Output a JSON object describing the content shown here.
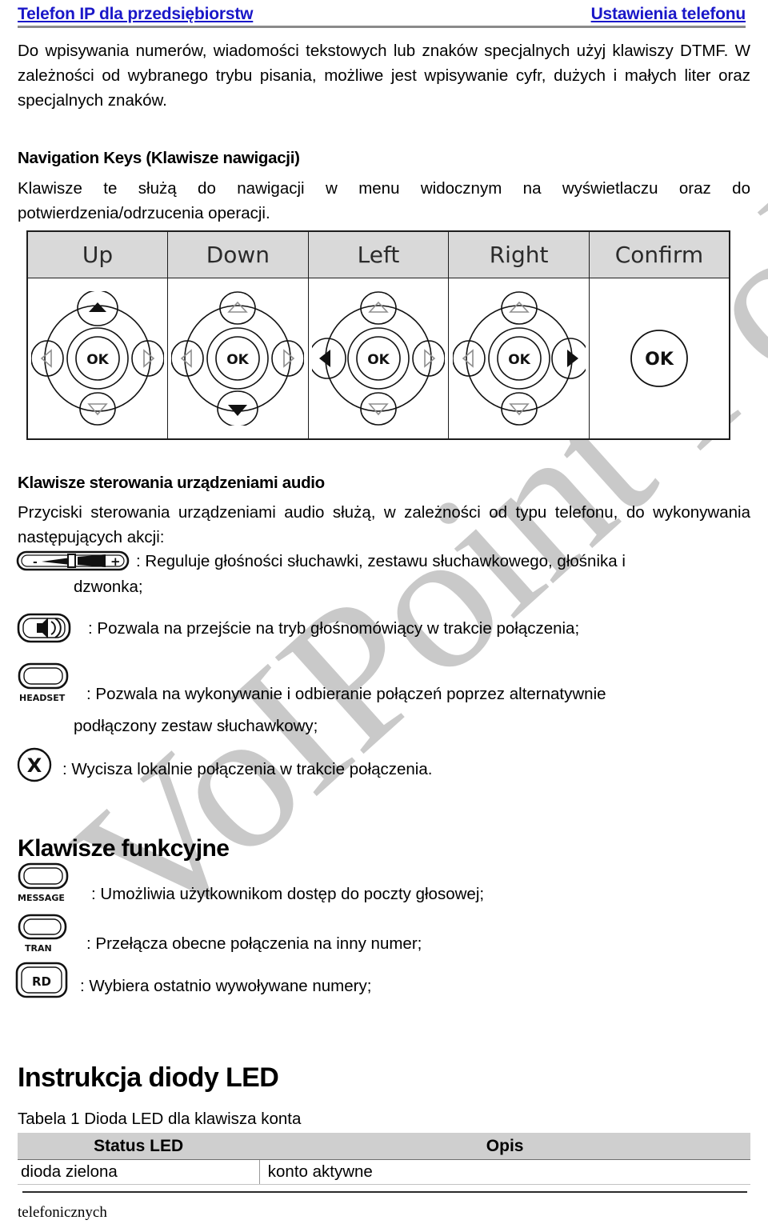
{
  "header": {
    "left": "Telefon IP dla przedsiębiorstw",
    "right": "Ustawienia telefonu",
    "color": "#1a17c8"
  },
  "intro_paragraph": "Do wpisywania numerów, wiadomości tekstowych lub znaków specjalnych użyj klawiszy DTMF. W zależności od wybranego trybu pisania, możliwe jest wpisywanie cyfr, dużych i małych liter oraz specjalnych znaków.",
  "navigation": {
    "heading": "Navigation Keys (Klawisze nawigacji)",
    "paragraph": "Klawisze te służą do nawigacji w menu widocznym na wyświetlaczu oraz do potwierdzenia/odrzucenia operacji.",
    "columns": [
      "Up",
      "Down",
      "Left",
      "Right",
      "Confirm"
    ],
    "ok_label": "OK",
    "header_bg": "#d9d9d9"
  },
  "audio": {
    "heading": "Klawisze sterowania urządzeniami audio",
    "paragraph": "Przyciski sterowania urządzeniami audio służą, w zależności od typu telefonu, do wykonywania następujących akcji:",
    "items": [
      {
        "icon": "volume-rocker-icon",
        "desc": ": Reguluje głośności słuchawki, zestawu słuchawkowego, głośnika i",
        "cont": "dzwonka;"
      },
      {
        "icon": "speaker-key-icon",
        "desc": ": Pozwala na przejście na tryb głośnomówiący w trakcie połączenia;",
        "cont": ""
      },
      {
        "icon": "headset-key-icon",
        "icon_label": "HEADSET",
        "desc": ":  Pozwala  na  wykonywanie  i  odbieranie  połączeń  poprzez  alternatywnie",
        "cont": "podłączony zestaw słuchawkowy;"
      },
      {
        "icon": "mute-key-icon",
        "desc": ": Wycisza lokalnie połączenia w trakcie połączenia.",
        "cont": ""
      }
    ]
  },
  "function_keys": {
    "heading": "Klawisze funkcyjne",
    "items": [
      {
        "icon": "message-key-icon",
        "icon_label": "MESSAGE",
        "desc": ": Umożliwia użytkownikom dostęp do poczty głosowej;"
      },
      {
        "icon": "transfer-key-icon",
        "icon_label": "TRAN",
        "desc": ":  Przełącza obecne połączenia na inny numer;"
      },
      {
        "icon": "redial-key-icon",
        "icon_label": "RD",
        "desc": ": Wybiera ostatnio wywoływane numery;"
      }
    ]
  },
  "led": {
    "heading": "Instrukcja diody LED",
    "caption": "Tabela 1 Dioda LED dla klawisza konta",
    "columns": [
      "Status LED",
      "Opis"
    ],
    "rows": [
      [
        "dioda zielona",
        "konto aktywne"
      ]
    ],
    "header_bg": "#cfcfcf"
  },
  "footer": {
    "text": "telefonicznych"
  },
  "watermark": {
    "text": "VoIPoint Pols",
    "color": "#c9c9c9"
  }
}
